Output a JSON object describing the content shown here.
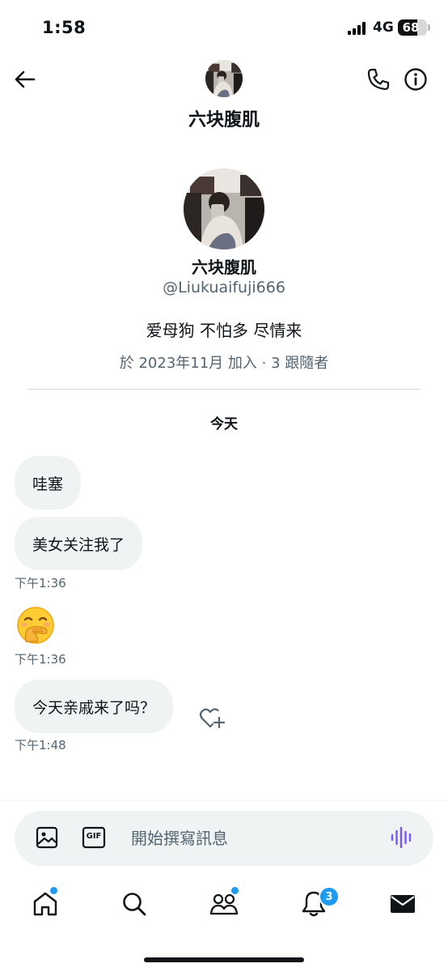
{
  "status_bar": {
    "time": "1:58",
    "network": "4G",
    "battery": "68",
    "battery_level": 0.68
  },
  "header": {
    "title": "六块腹肌"
  },
  "profile": {
    "name": "六块腹肌",
    "handle": "@Liukuaifuji666",
    "bio": "爱母狗 不怕多 尽情来",
    "meta": "於 2023年11月 加入 · 3 跟隨者"
  },
  "conversation": {
    "date_label": "今天",
    "messages": [
      {
        "text": "哇塞"
      },
      {
        "text": "美女关注我了",
        "time": "下午1:36"
      },
      {
        "emoji": "hand-over-mouth-emoji",
        "time": "下午1:36"
      },
      {
        "text": "今天亲戚来了吗？",
        "time": "下午1:48"
      }
    ]
  },
  "composer": {
    "placeholder": "開始撰寫訊息",
    "gif_label": "GIF"
  },
  "nav": {
    "notifications_count": "3"
  },
  "colors": {
    "accent": "#1d9bf0",
    "voice": "#7856ff",
    "bubble": "#eff3f4",
    "muted": "#536471"
  }
}
